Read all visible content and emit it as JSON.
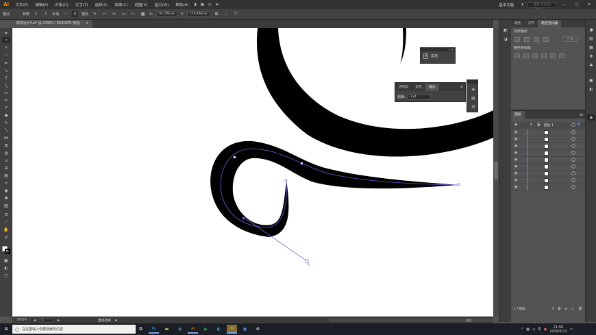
{
  "app": {
    "logo": "Ai",
    "menu": [
      "文件(F)",
      "编辑(E)",
      "对象(O)",
      "文字(T)",
      "选择(S)",
      "效果(C)",
      "视图(V)",
      "窗口(W)",
      "帮助(H)"
    ],
    "workspace": "基本功能",
    "search_placeholder": "搜索 Adobe Stock"
  },
  "control": {
    "selection_label": "锚点",
    "convert_label": "转换",
    "handles_label": "手柄",
    "anchors_label": "锚点",
    "x_value": "92.706 px",
    "y_value": "119.469 px"
  },
  "document": {
    "tab": "服装设计4.ai* @ 2400% (RGB/GPU 预览)",
    "close": "×"
  },
  "status": {
    "zoom": "2400%",
    "page": "1",
    "tool_name": "直接选择"
  },
  "char_panel": {
    "label": "字符"
  },
  "stroke_panel": {
    "tabs": [
      "透明度",
      "渐变",
      "描边"
    ],
    "weight_label": "粗细:",
    "weight_value": "3 pt"
  },
  "right_panel": {
    "tabs": [
      "属性",
      "对齐",
      "路径查找器"
    ],
    "shape_modes_label": "形状模式:",
    "expand_label": "扩展",
    "pathfinder_label": "路径查找器:",
    "layers_tab": "图层",
    "layer_name": "图层 1",
    "layers_count": "1 个图层",
    "layer_rows": 9
  },
  "taskbar": {
    "search_text": "在这里输入你要搜索的内容",
    "time": "21:56",
    "date": "2020/5/12",
    "ime": "中"
  }
}
